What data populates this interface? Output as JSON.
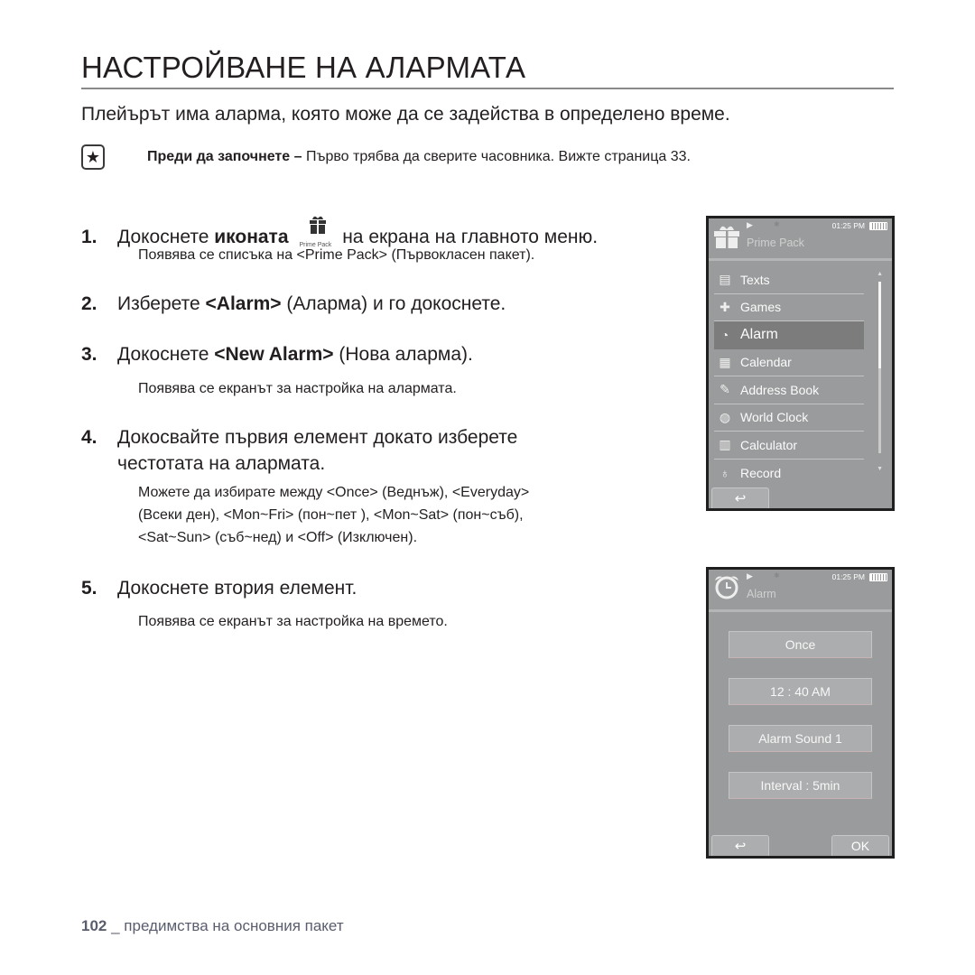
{
  "page": {
    "title": "НАСТРОЙВАНЕ НА АЛАРМАТА",
    "lead": "Плейърът има аларма, която може да се задейства в определено време.",
    "note": {
      "icon": "star-note-icon",
      "bold": "Преди да започнете –",
      "text": " Първо трябва да сверите часовника. Вижте страница 33."
    },
    "steps": [
      {
        "num": "1.",
        "pre": "Докоснете ",
        "bold": "иконата",
        "icon_caption": "Prime Pack",
        "post": " на екрана на главното меню.",
        "sub": "Появява се списъка на <Prime Pack> (Първокласен пакет)."
      },
      {
        "num": "2.",
        "pre": "Изберете ",
        "bold": "<Alarm>",
        "post": " (Аларма) и го докоснете."
      },
      {
        "num": "3.",
        "pre": "Докоснете ",
        "bold": "<New Alarm>",
        "post": " (Нова аларма).",
        "sub": "Появява се екранът за настройка на алармата."
      },
      {
        "num": "4.",
        "line1": "Докосвайте първия елемент докато изберете",
        "line2": "честотата на алармата.",
        "sub1": "Можете да избирате между <Once> (Веднъж), <Everyday>",
        "sub2": "(Всеки ден), <Mon~Fri> (пон~пет ), <Mon~Sat> (пон~съб),",
        "sub3": "<Sat~Sun> (съб~нед) и <Off> (Изключен)."
      },
      {
        "num": "5.",
        "text": "Докоснете втория елемент.",
        "sub": "Появява се екранът за настройка на времето."
      }
    ],
    "footer": {
      "page_num": "102",
      "sep": " _ ",
      "text": "предимства на основния пакет"
    }
  },
  "screen1": {
    "app_title": "Prime Pack",
    "time": "01:25 PM",
    "play_glyph": "▶",
    "items": [
      {
        "label": "Texts",
        "icon": "document-icon",
        "glyph": "▤"
      },
      {
        "label": "Games",
        "icon": "gamepad-icon",
        "glyph": "🎮"
      },
      {
        "label": "Alarm",
        "icon": "stopwatch-icon",
        "glyph": "⏱",
        "selected": true
      },
      {
        "label": "Calendar",
        "icon": "calendar-icon",
        "glyph": "▦"
      },
      {
        "label": "Address Book",
        "icon": "address-book-icon",
        "glyph": "✎"
      },
      {
        "label": "World Clock",
        "icon": "globe-icon",
        "glyph": "◍"
      },
      {
        "label": "Calculator",
        "icon": "calculator-icon",
        "glyph": "▥"
      },
      {
        "label": "Record",
        "icon": "microphone-icon",
        "glyph": "🎙"
      }
    ],
    "back_glyph": "↩",
    "scroll_position": 0
  },
  "screen2": {
    "app_title": "Alarm",
    "time": "01:25 PM",
    "play_glyph": "▶",
    "options": [
      "Once",
      "12 : 40 AM",
      "Alarm Sound 1",
      "Interval : 5min"
    ],
    "back_glyph": "↩",
    "ok_label": "OK"
  }
}
